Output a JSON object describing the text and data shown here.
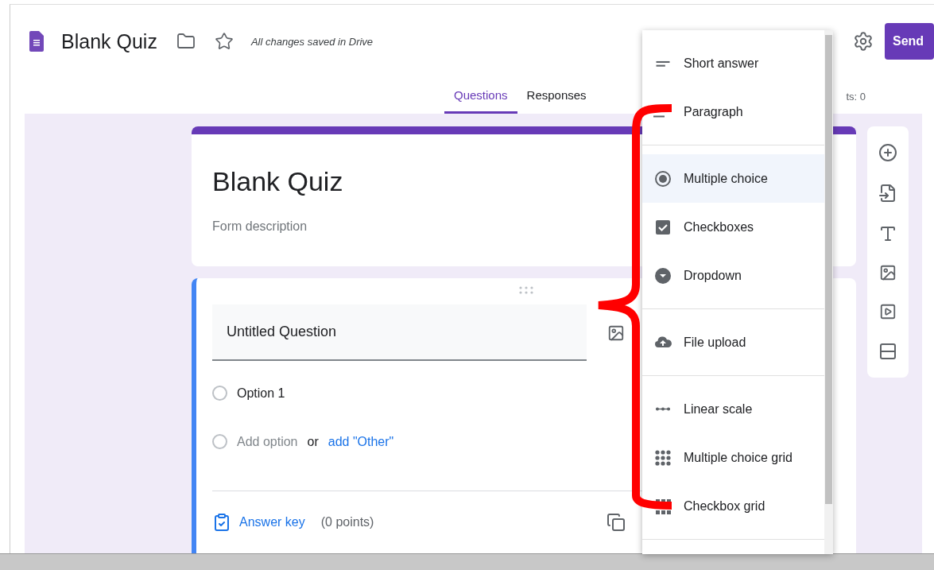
{
  "header": {
    "title": "Blank Quiz",
    "status": "All changes saved in Drive",
    "send_label": "Send"
  },
  "tabs": [
    {
      "label": "Questions",
      "selected": true
    },
    {
      "label": "Responses",
      "selected": false
    }
  ],
  "points_fragment": "ts: 0",
  "form": {
    "title": "Blank Quiz",
    "description_placeholder": "Form description"
  },
  "question": {
    "title": "Untitled Question",
    "options": [
      {
        "label": "Option 1",
        "checked": false
      }
    ],
    "add_option": "Add option",
    "add_option_checked": false,
    "or": "or",
    "add_other": "add \"Other\"",
    "answer_key": "Answer key",
    "points": "(0 points)"
  },
  "type_menu": {
    "groups": [
      {
        "items": [
          {
            "label": "Short answer",
            "kind": "short",
            "selected": false
          },
          {
            "label": "Paragraph",
            "kind": "paragraph",
            "selected": false
          }
        ]
      },
      {
        "items": [
          {
            "label": "Multiple choice",
            "kind": "radio",
            "selected": true
          },
          {
            "label": "Checkboxes",
            "kind": "checkbox",
            "selected": false
          },
          {
            "label": "Dropdown",
            "kind": "dropdown",
            "selected": false
          }
        ]
      },
      {
        "items": [
          {
            "label": "File upload",
            "kind": "upload",
            "selected": false
          }
        ]
      },
      {
        "items": [
          {
            "label": "Linear scale",
            "kind": "scale",
            "selected": false
          },
          {
            "label": "Multiple choice grid",
            "kind": "dotgrid",
            "selected": false
          },
          {
            "label": "Checkbox grid",
            "kind": "squaregrid",
            "selected": false
          }
        ]
      }
    ]
  }
}
